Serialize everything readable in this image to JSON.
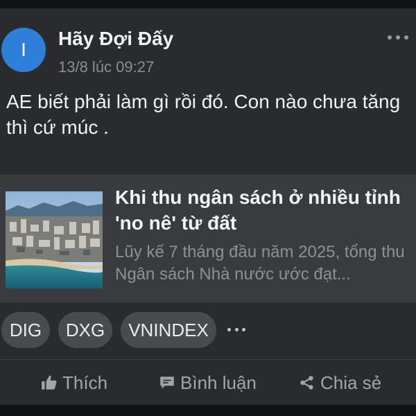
{
  "post": {
    "avatar_letter": "I",
    "author": "Hãy Đợi Đấy",
    "time": "13/8 lúc 09:27",
    "text": "AE biết phải làm gì rồi đó. Con nào chưa tăng thì cứ múc .",
    "more_icon": "more-horizontal-icon"
  },
  "link_preview": {
    "title": "Khi thu ngân sách ở nhiều tỉnh 'no nê' từ đất",
    "description": "Lũy kế 7 tháng đầu năm 2025, tổng thu Ngân sách Nhà nước ước đạt...",
    "thumbnail": "coastal-city-aerial-photo"
  },
  "tags": [
    "DIG",
    "DXG",
    "VNINDEX"
  ],
  "actions": {
    "like": "Thích",
    "comment": "Bình luận",
    "share": "Chia sẻ"
  },
  "colors": {
    "background": "#111214",
    "card": "#2a2b2d",
    "preview": "#3a3b3e",
    "avatar": "#2d7fd8",
    "tag": "#4a4b4e",
    "muted_text": "#8e8f94"
  }
}
